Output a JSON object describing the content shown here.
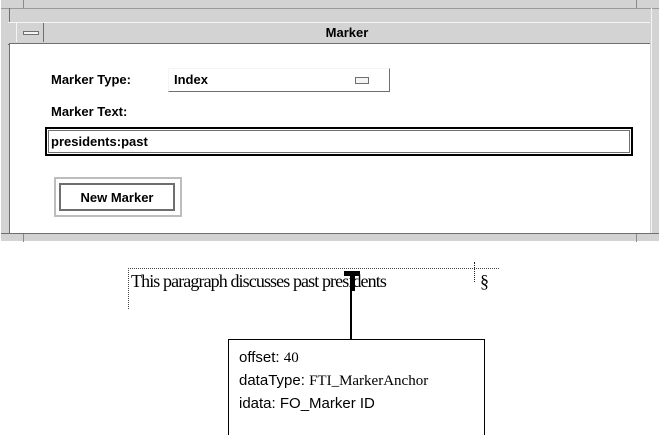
{
  "dialog": {
    "title": "Marker",
    "marker_type_label": "Marker Type:",
    "marker_type_value": "Index",
    "marker_text_label": "Marker Text:",
    "marker_text_value": "presidents:past",
    "new_marker_button": "New Marker"
  },
  "illustration": {
    "paragraph_text": "This paragraph discusses past presidents",
    "end_mark": "§",
    "info": {
      "offset_label": "offset:",
      "offset_value": "40",
      "datatype_label": "dataType:",
      "datatype_value": "FTI_MarkerAnchor",
      "idata_label": "idata:",
      "idata_value": "FO_Marker ID"
    }
  },
  "icons": {
    "window_menu": "window-menu-icon",
    "option_menu": "option-menu-indicator-icon",
    "marker_anchor": "marker-anchor-icon"
  },
  "colors": {
    "window_bg": "#d3d3d3",
    "panel_bg": "#ffffff",
    "text": "#000000"
  }
}
